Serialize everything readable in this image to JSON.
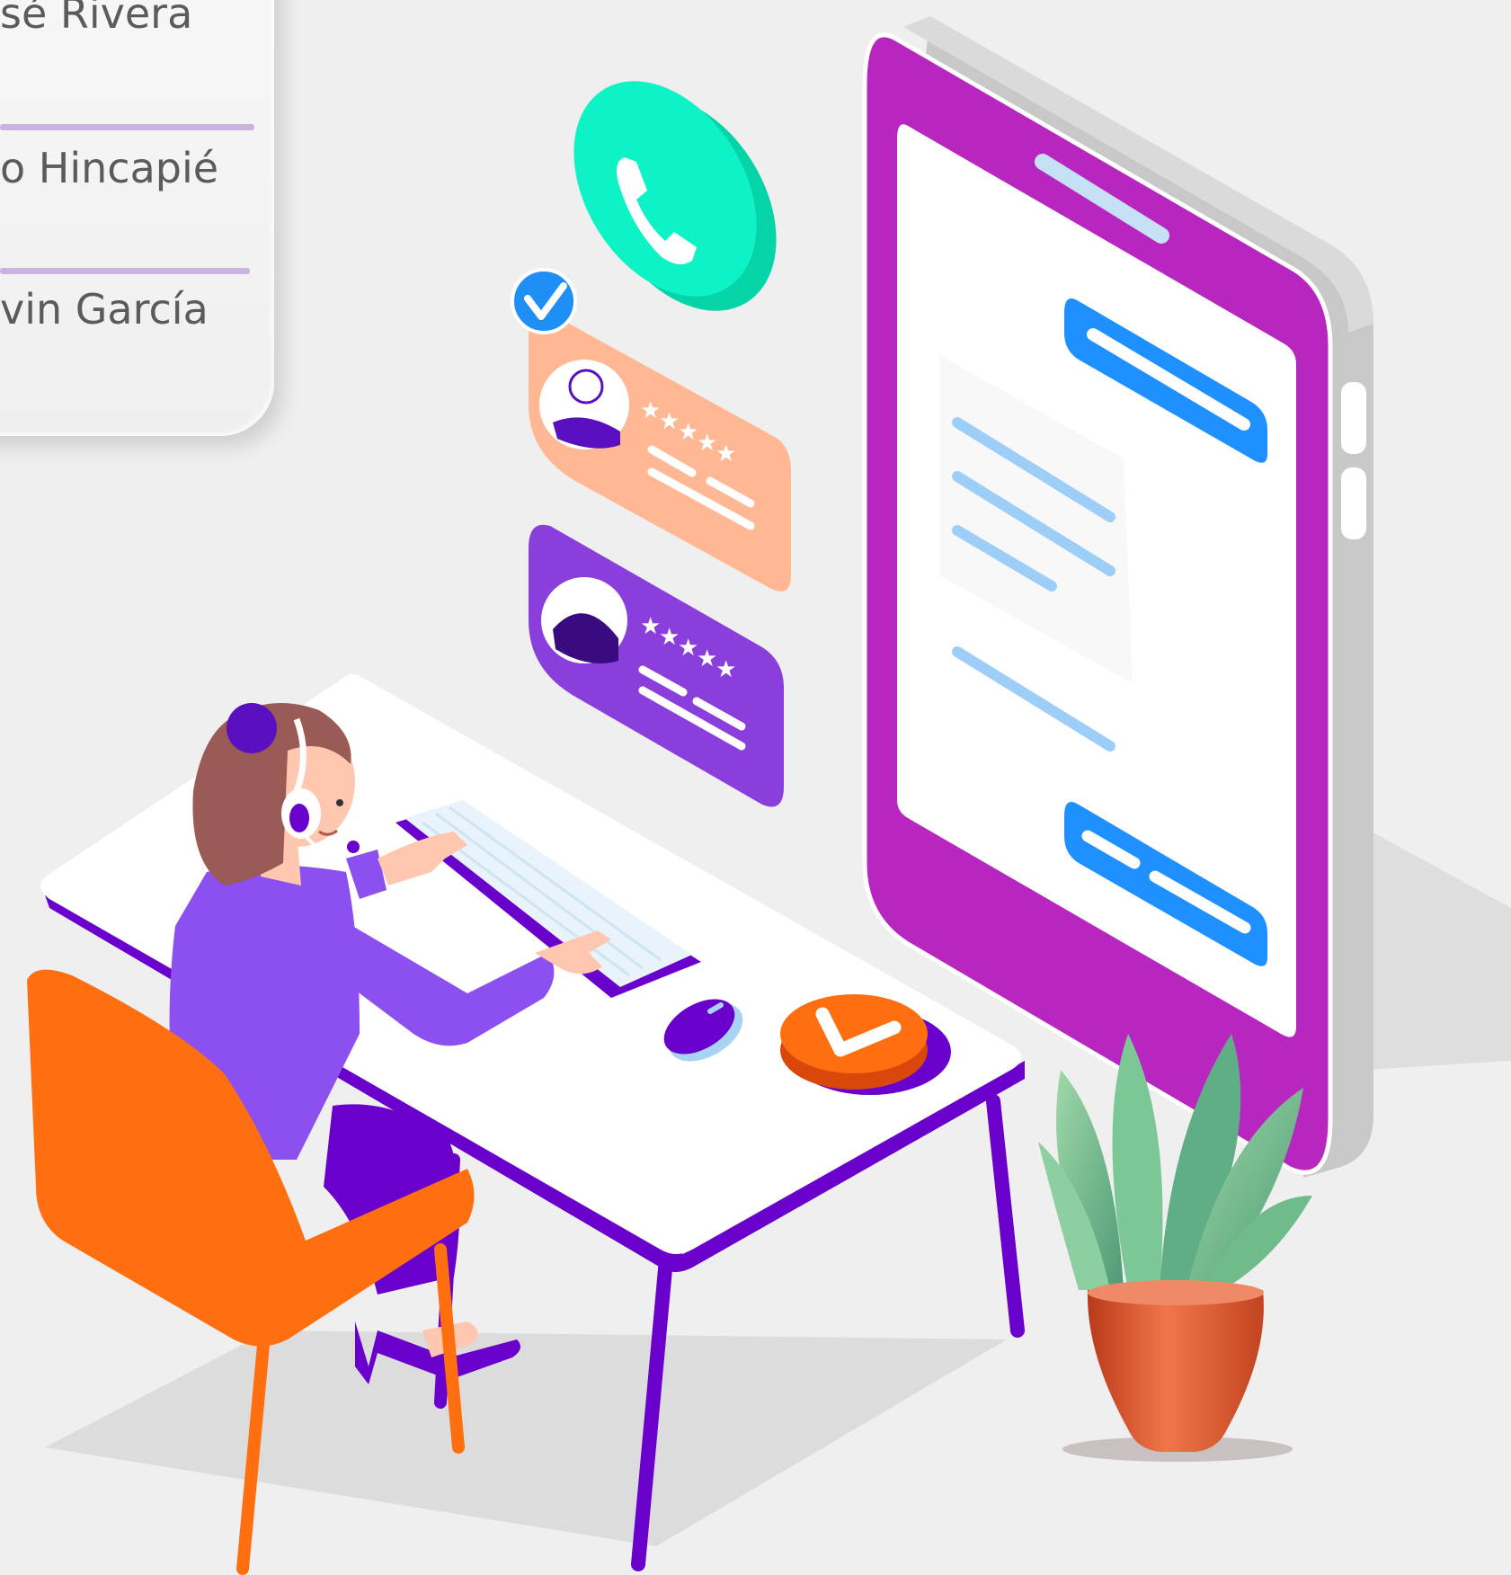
{
  "agent_list": {
    "names": [
      "sé Rivera",
      "o Hincapié",
      "vin García"
    ]
  },
  "illustration": {
    "subject": "customer-support-agent",
    "colors": {
      "background": "#efefef",
      "phone_frame": "#b826c0",
      "phone_side": "#c8c8c8",
      "chat_bubble": "#1e90ff",
      "chat_line": "#9ccef7",
      "call_icon": "#0ef3c6",
      "review_card_orange": "#ffb893",
      "review_card_purple": "#8a3fdc",
      "check_badge": "#1f8ff5",
      "desk_top": "#ffffff",
      "desk_frame": "#6a00cc",
      "chair": "#ff6f10",
      "shirt": "#8c4ff0",
      "hair": "#9a5a55",
      "plant_leaf": "#6fbb8a",
      "plant_pot": "#e0552c"
    }
  }
}
